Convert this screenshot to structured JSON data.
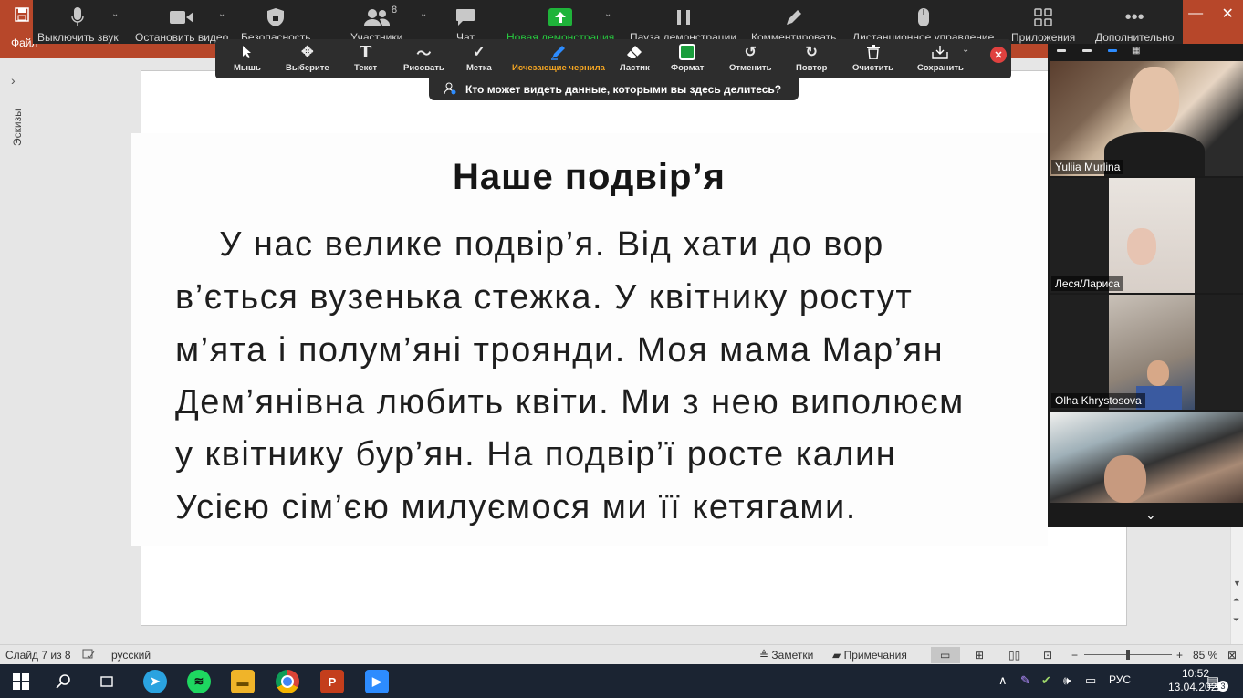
{
  "powerpoint": {
    "file_tab": "Файл",
    "thumbnails_label": "Эскизы",
    "slide": {
      "title": "Наше подвір’я",
      "lines": [
        "    У нас велике подвір’я. Від хати до вор",
        "в’ється вузенька стежка. У квітнику ростут",
        "м’ята і полум’яні троянди. Моя мама Мар’ян",
        "Дем’янівна любить квіти. Ми з нею виполюєм",
        "у квітнику бур’ян. На подвір’ї росте калин",
        "Усією сім’єю милуємося ми її кетягами."
      ]
    },
    "status": {
      "slide_info": "Слайд 7 из 8",
      "language": "русский",
      "notes": "Заметки",
      "comments": "Примечания",
      "zoom_minus": "−",
      "zoom_plus": "+",
      "zoom_level": "85 %",
      "zoom_fraction": 0.5
    }
  },
  "zoom_toolbar": {
    "mute": "Выключить звук",
    "video": "Остановить видео",
    "security": "Безопасность",
    "participants": "Участники",
    "participants_count": "8",
    "chat": "Чат",
    "new_share": "Новая демонстрация",
    "pause_share": "Пауза демонстрации",
    "annotate": "Комментировать",
    "remote_control": "Дистанционное управление",
    "apps": "Приложения",
    "more": "Дополнительно"
  },
  "annotate_toolbar": {
    "mouse": "Мышь",
    "select": "Выберите",
    "text": "Текст",
    "draw": "Рисовать",
    "stamp": "Метка",
    "vanishing_pen": "Исчезающие чернила",
    "eraser": "Ластик",
    "format": "Формат",
    "undo": "Отменить",
    "redo": "Повтор",
    "clear": "Очистить",
    "save": "Сохранить",
    "active_color": "#f5a623",
    "format_color": "#1a9e3c",
    "close_color": "#e0413f"
  },
  "share_banner": "Кто может видеть данные, которыми вы здесь делитесь?",
  "video_panel": {
    "participants": [
      {
        "name": "Yuliia Murlina"
      },
      {
        "name": "Леся/Лариса"
      },
      {
        "name": "Olha Khrystosova"
      },
      {
        "name": ""
      }
    ]
  },
  "taskbar": {
    "tray_language": "РУС",
    "time": "10:52",
    "date": "13.04.2022",
    "notifications": "3"
  }
}
